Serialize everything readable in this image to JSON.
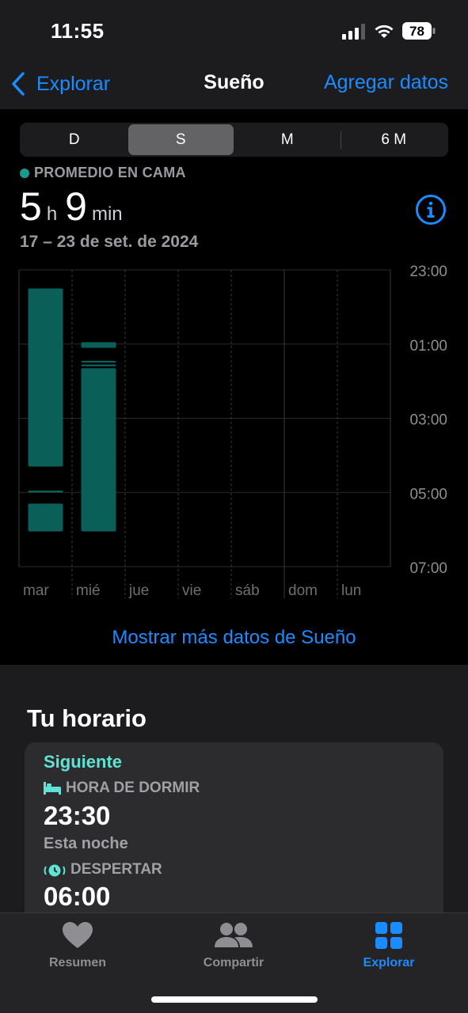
{
  "status": {
    "time": "11:55",
    "battery": "78"
  },
  "nav": {
    "back_label": "Explorar",
    "title": "Sueño",
    "action_label": "Agregar datos"
  },
  "segments": {
    "items": [
      "D",
      "S",
      "M",
      "6 M"
    ],
    "selected": "S"
  },
  "summary": {
    "category": "PROMEDIO EN CAMA",
    "hours": "5",
    "hours_unit": "h",
    "minutes": "9",
    "minutes_unit": "min",
    "range": "17 – 23 de set. de 2024"
  },
  "chart_data": {
    "type": "bar",
    "categories": [
      "mar",
      "mié",
      "jue",
      "vie",
      "sáb",
      "dom",
      "lun"
    ],
    "y_ticks": [
      "23:00",
      "01:00",
      "03:00",
      "05:00",
      "07:00"
    ],
    "y_range_hours": [
      23,
      31
    ],
    "color": "#0b5f59",
    "series": [
      {
        "segments": [
          {
            "category": "mar",
            "start": 23.5,
            "end": 28.3
          },
          {
            "category": "mar",
            "start": 28.95,
            "end": 29.0
          },
          {
            "category": "mar",
            "start": 29.3,
            "end": 30.05
          },
          {
            "category": "mié",
            "start": 24.95,
            "end": 25.1
          },
          {
            "category": "mié",
            "start": 25.45,
            "end": 25.5
          },
          {
            "category": "mié",
            "start": 25.55,
            "end": 25.6
          },
          {
            "category": "mié",
            "start": 25.65,
            "end": 30.05
          }
        ]
      }
    ]
  },
  "more_link": "Mostrar más datos de Sueño",
  "schedule": {
    "title": "Tu horario",
    "next_label": "Siguiente",
    "bedtime_label": "HORA DE DORMIR",
    "bedtime": "23:30",
    "bedtime_when": "Esta noche",
    "wake_label": "DESPERTAR",
    "wake": "06:00"
  },
  "tabs": [
    {
      "label": "Resumen",
      "icon": "heart-icon"
    },
    {
      "label": "Compartir",
      "icon": "people-icon"
    },
    {
      "label": "Explorar",
      "icon": "grid-icon",
      "active": true
    }
  ],
  "colors": {
    "accent": "#1a8cff",
    "sleep": "#0b5f59",
    "next": "#5ee3d4"
  }
}
